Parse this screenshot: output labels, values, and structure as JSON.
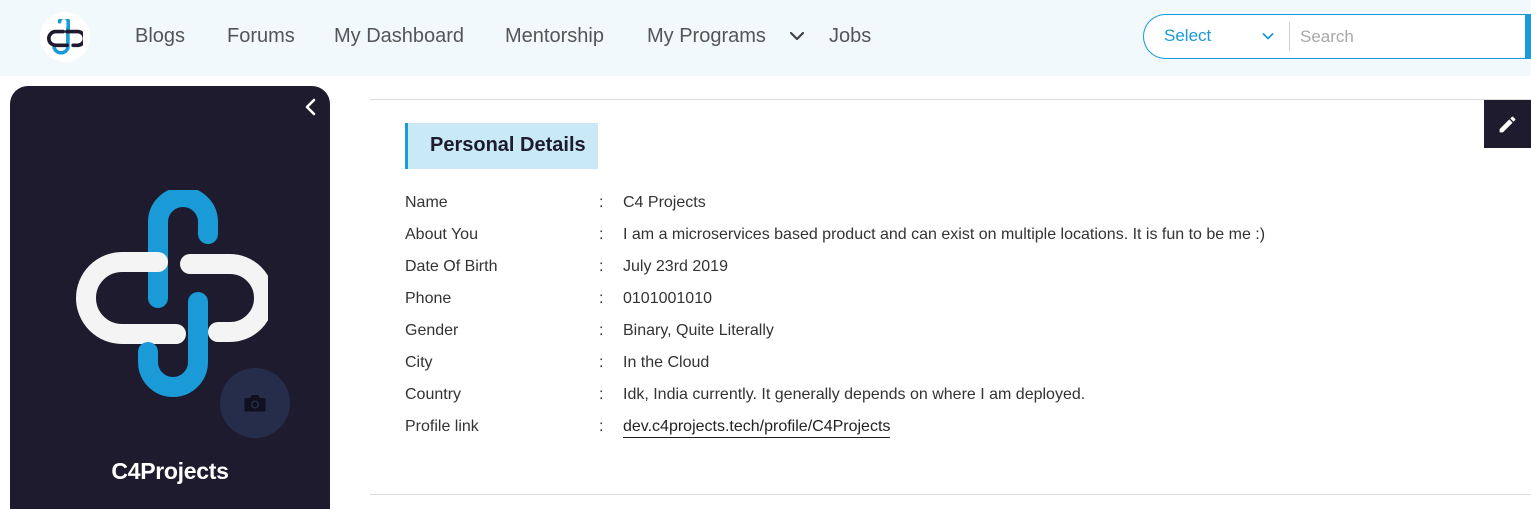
{
  "colors": {
    "brand": "#1a9bd7",
    "dark": "#1e1b2e",
    "header_bg": "#f1f9fd",
    "section_bg": "#c9e9f6"
  },
  "nav": {
    "logo_icon": "c4-logo-icon",
    "items": [
      {
        "label": "Blogs"
      },
      {
        "label": "Forums"
      },
      {
        "label": "My Dashboard"
      },
      {
        "label": "Mentorship"
      },
      {
        "label": "My Programs"
      },
      {
        "label": "Jobs"
      }
    ],
    "programs_dropdown_icon": "chevron-down-icon"
  },
  "search": {
    "select_value": "Select",
    "placeholder": "Search",
    "value": ""
  },
  "profile": {
    "name": "C4Projects",
    "collapse_icon": "chevron-left-icon",
    "camera_icon": "camera-icon"
  },
  "details": {
    "section_title": "Personal Details",
    "edit_icon": "pencil-icon",
    "separator": ":",
    "rows": [
      {
        "label": "Name",
        "value": "C4 Projects"
      },
      {
        "label": "About You",
        "value": "I am a microservices based product and can exist on multiple locations. It is fun to be me :)"
      },
      {
        "label": "Date Of Birth",
        "value": "July 23rd 2019"
      },
      {
        "label": "Phone",
        "value": "0101001010"
      },
      {
        "label": "Gender",
        "value": "Binary, Quite Literally"
      },
      {
        "label": "City",
        "value": "In the Cloud"
      },
      {
        "label": "Country",
        "value": "Idk, India currently. It generally depends on where I am deployed."
      },
      {
        "label": "Profile link",
        "value": "dev.c4projects.tech/profile/C4Projects"
      }
    ]
  }
}
